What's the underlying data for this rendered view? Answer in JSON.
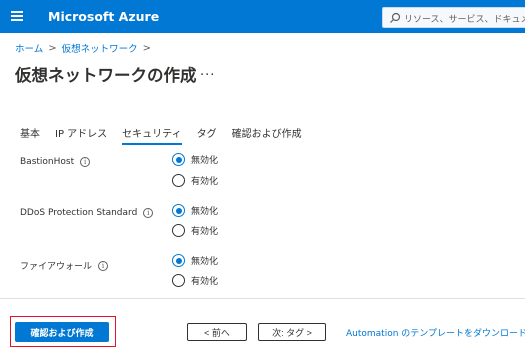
{
  "header": {
    "app_title": "Microsoft Azure",
    "search_placeholder": "リソース、サービス、ドキュメントの検索 (G+/)"
  },
  "breadcrumb": {
    "items": [
      "ホーム",
      "仮想ネットワーク"
    ],
    "separator": ">"
  },
  "page": {
    "title": "仮想ネットワークの作成",
    "more": "..."
  },
  "tabs": [
    {
      "label": "基本",
      "active": false
    },
    {
      "label": "IP アドレス",
      "active": false
    },
    {
      "label": "セキュリティ",
      "active": true
    },
    {
      "label": "タグ",
      "active": false
    },
    {
      "label": "確認および作成",
      "active": false
    }
  ],
  "settings": [
    {
      "label": "BastionHost",
      "options": [
        "無効化",
        "有効化"
      ],
      "selected": "無効化"
    },
    {
      "label": "DDoS Protection Standard",
      "options": [
        "無効化",
        "有効化"
      ],
      "selected": "無効化"
    },
    {
      "label": "ファイアウォール",
      "options": [
        "無効化",
        "有効化"
      ],
      "selected": "無効化"
    }
  ],
  "footer": {
    "review_create": "確認および作成",
    "prev": "< 前へ",
    "next": "次: タグ >",
    "automation_link": "Automation のテンプレートをダウンロードする"
  },
  "colors": {
    "accent": "#0078d4",
    "highlight": "#e81123"
  }
}
